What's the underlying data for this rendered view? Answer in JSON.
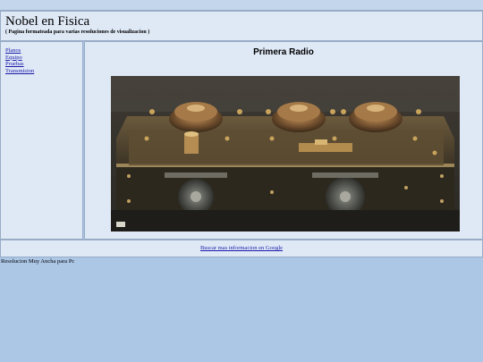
{
  "header": {
    "title": "Nobel en Fisica",
    "subtitle": "( Pagina formateada para varias resoluciones de visualizacion )"
  },
  "sidebar": {
    "links": [
      "Planos",
      "Equipo",
      "Pruebas",
      "Transmision"
    ]
  },
  "main": {
    "heading": "Primera Radio",
    "image_label": "Primera Radio photo"
  },
  "footer": {
    "link_text": "Buscar mas informacion en Google",
    "note": "Resolucion Muy Ancha para Pc"
  },
  "colors": {
    "page_bg": "#acc6e6",
    "panel_bg": "#dfe9f6",
    "border": "#98acc6",
    "link": "#1a1aa8"
  }
}
